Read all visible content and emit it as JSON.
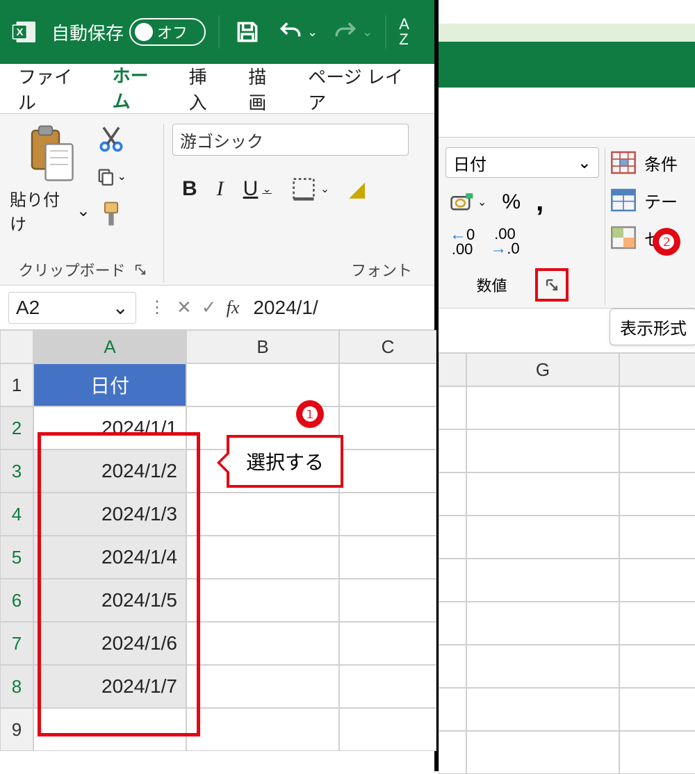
{
  "titlebar": {
    "autosave_label": "自動保存",
    "autosave_state": "オフ",
    "sort_az": "A\nZ"
  },
  "tabs": {
    "file": "ファイル",
    "home": "ホーム",
    "insert": "挿入",
    "draw": "描画",
    "page_layout": "ページ レイア"
  },
  "ribbon": {
    "clipboard": {
      "paste_label": "貼り付け",
      "group_label": "クリップボード"
    },
    "font": {
      "name": "游ゴシック",
      "bold": "B",
      "italic": "I",
      "underline": "U",
      "group_label": "フォント"
    },
    "number": {
      "format": "日付",
      "group_label": "数値",
      "dec_left_top": "←0",
      "dec_left_bottom": ".00",
      "dec_right_top": ".00",
      "dec_right_bottom": "→.0"
    },
    "styles": {
      "conditional": "条件",
      "table": "テー",
      "cell": "セル"
    },
    "tooltip": "表示形式"
  },
  "namebox": {
    "ref": "A2"
  },
  "formula": {
    "value": "2024/1/"
  },
  "columns": {
    "A": "A",
    "B": "B",
    "C": "C",
    "G": "G"
  },
  "rows": [
    "1",
    "2",
    "3",
    "4",
    "5",
    "6",
    "7",
    "8",
    "9"
  ],
  "sheet": {
    "header": "日付",
    "dates": [
      "2024/1/1",
      "2024/1/2",
      "2024/1/3",
      "2024/1/4",
      "2024/1/5",
      "2024/1/6",
      "2024/1/7"
    ]
  },
  "annotations": {
    "badge1": "❶",
    "badge2": "❷",
    "callout": "選択する"
  }
}
